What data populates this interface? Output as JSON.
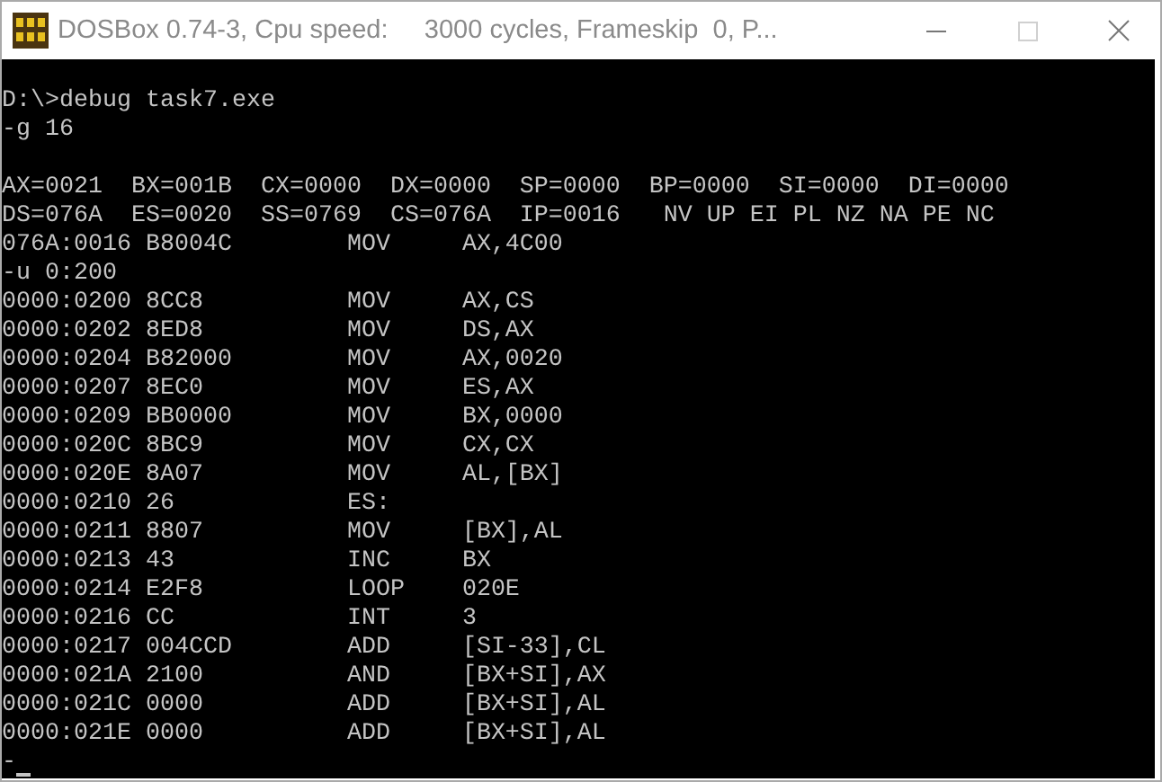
{
  "window": {
    "title": "DOSBox 0.74-3, Cpu speed:     3000 cycles, Frameskip  0, P...",
    "active": false,
    "controls": [
      {
        "kind": "minimize",
        "disabled": false
      },
      {
        "kind": "maximize",
        "disabled": true
      },
      {
        "kind": "close",
        "disabled": false
      }
    ]
  },
  "terminal": {
    "lines": [
      {
        "text": "D:\\>debug task7.exe",
        "blank_before": true
      },
      {
        "text": "-g 16"
      },
      {
        "text": "AX=0021  BX=001B  CX=0000  DX=0000  SP=0000  BP=0000  SI=0000  DI=0000",
        "blank_before": true
      },
      {
        "text": "DS=076A  ES=0020  SS=0769  CS=076A  IP=0016   NV UP EI PL NZ NA PE NC"
      },
      {
        "text": "076A:0016 B8004C        MOV     AX,4C00"
      },
      {
        "text": "-u 0:200"
      },
      {
        "text": "0000:0200 8CC8          MOV     AX,CS"
      },
      {
        "text": "0000:0202 8ED8          MOV     DS,AX"
      },
      {
        "text": "0000:0204 B82000        MOV     AX,0020"
      },
      {
        "text": "0000:0207 8EC0          MOV     ES,AX"
      },
      {
        "text": "0000:0209 BB0000        MOV     BX,0000"
      },
      {
        "text": "0000:020C 8BC9          MOV     CX,CX"
      },
      {
        "text": "0000:020E 8A07          MOV     AL,[BX]"
      },
      {
        "text": "0000:0210 26            ES:"
      },
      {
        "text": "0000:0211 8807          MOV     [BX],AL"
      },
      {
        "text": "0000:0213 43            INC     BX"
      },
      {
        "text": "0000:0214 E2F8          LOOP    020E"
      },
      {
        "text": "0000:0216 CC            INT     3"
      },
      {
        "text": "0000:0217 004CCD        ADD     [SI-33],CL"
      },
      {
        "text": "0000:021A 2100          AND     [BX+SI],AX"
      },
      {
        "text": "0000:021C 0000          ADD     [BX+SI],AL"
      },
      {
        "text": "0000:021E 0000          ADD     [BX+SI],AL"
      },
      {
        "text": "-",
        "cursor": true
      }
    ]
  }
}
